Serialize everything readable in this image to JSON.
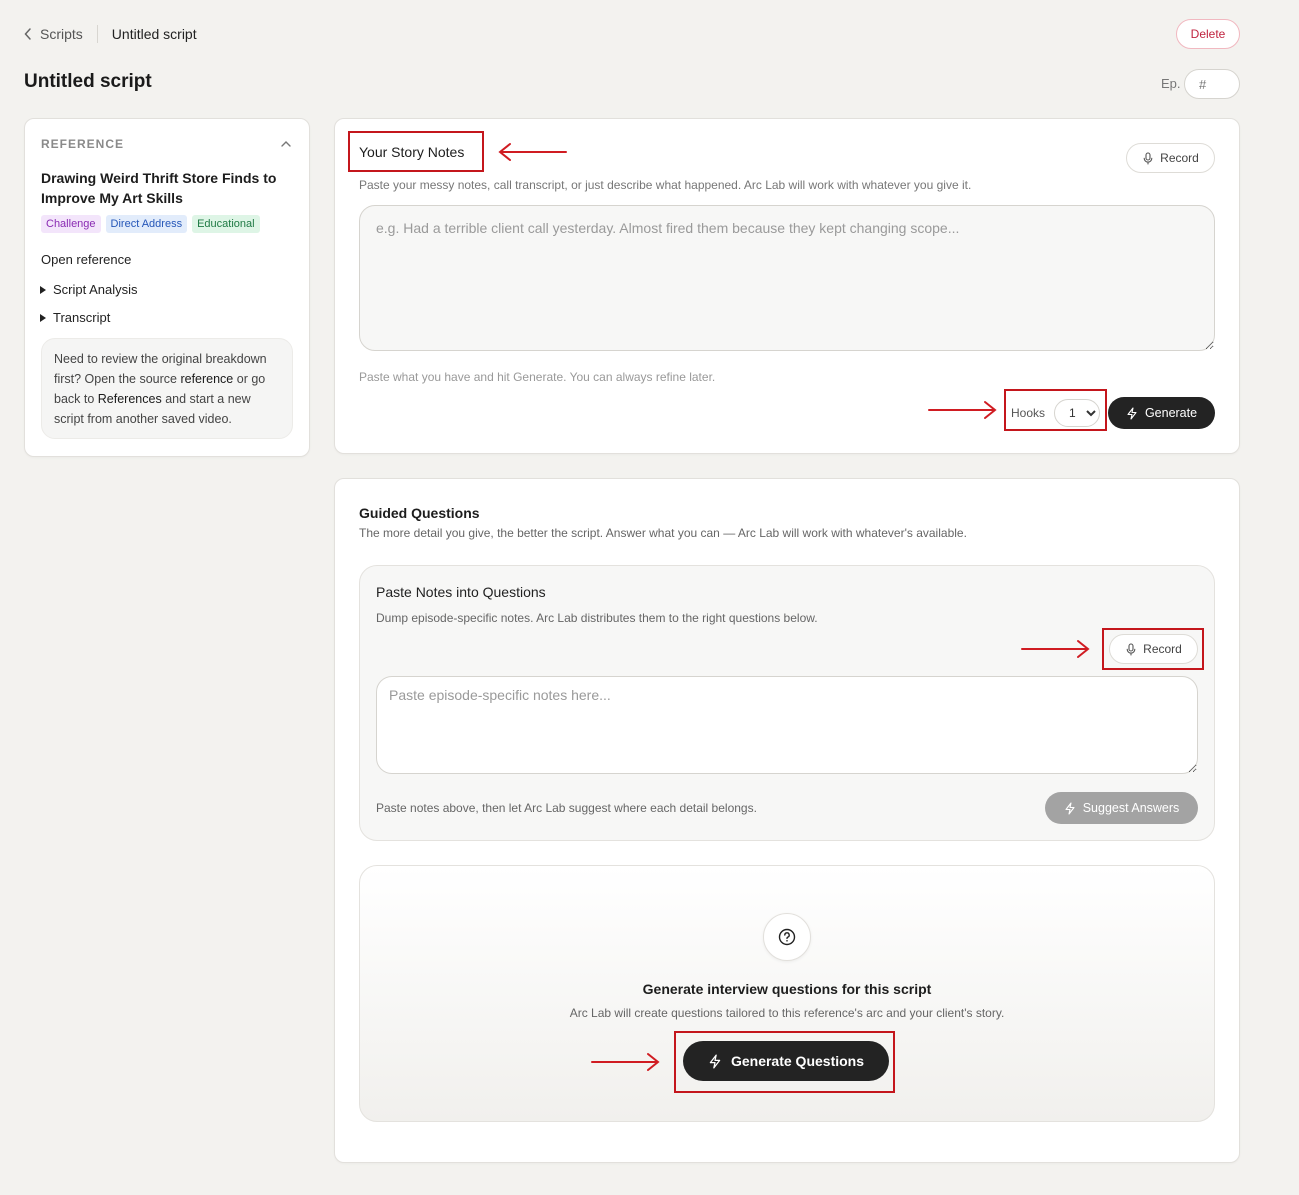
{
  "breadcrumb": {
    "back_label": "Scripts",
    "current": "Untitled script"
  },
  "header": {
    "title": "Untitled script",
    "delete_label": "Delete",
    "episode_label": "Ep.",
    "episode_placeholder": "#"
  },
  "reference": {
    "heading": "REFERENCE",
    "title": "Drawing Weird Thrift Store Finds to Improve My Art Skills",
    "tags": [
      "Challenge",
      "Direct Address",
      "Educational"
    ],
    "open_link": "Open reference",
    "sections": [
      "Script Analysis",
      "Transcript"
    ],
    "help": {
      "part1": "Need to review the original breakdown first? Open the source ",
      "link1": "reference",
      "part2": " or go back to ",
      "link2": "References",
      "part3": " and start a new script from another saved video."
    }
  },
  "story_notes": {
    "title": "Your Story Notes",
    "description": "Paste your messy notes, call transcript, or just describe what happened. Arc Lab will work with whatever you give it.",
    "record_label": "Record",
    "placeholder": "e.g. Had a terrible client call yesterday. Almost fired them because they kept changing scope...",
    "hint": "Paste what you have and hit Generate. You can always refine later.",
    "hooks_label": "Hooks",
    "hooks_value": "1",
    "generate_label": "Generate"
  },
  "guided": {
    "title": "Guided Questions",
    "description": "The more detail you give, the better the script. Answer what you can — Arc Lab will work with whatever's available.",
    "paste": {
      "title": "Paste Notes into Questions",
      "description": "Dump episode-specific notes. Arc Lab distributes them to the right questions below.",
      "record_label": "Record",
      "placeholder": "Paste episode-specific notes here...",
      "hint": "Paste notes above, then let Arc Lab suggest where each detail belongs.",
      "suggest_label": "Suggest Answers"
    },
    "generate": {
      "title": "Generate interview questions for this script",
      "description": "Arc Lab will create questions tailored to this reference's arc and your client's story.",
      "button_label": "Generate Questions"
    }
  },
  "colors": {
    "annotation": "#c4161c",
    "primary_button": "#232323",
    "delete": "#c0233f"
  }
}
